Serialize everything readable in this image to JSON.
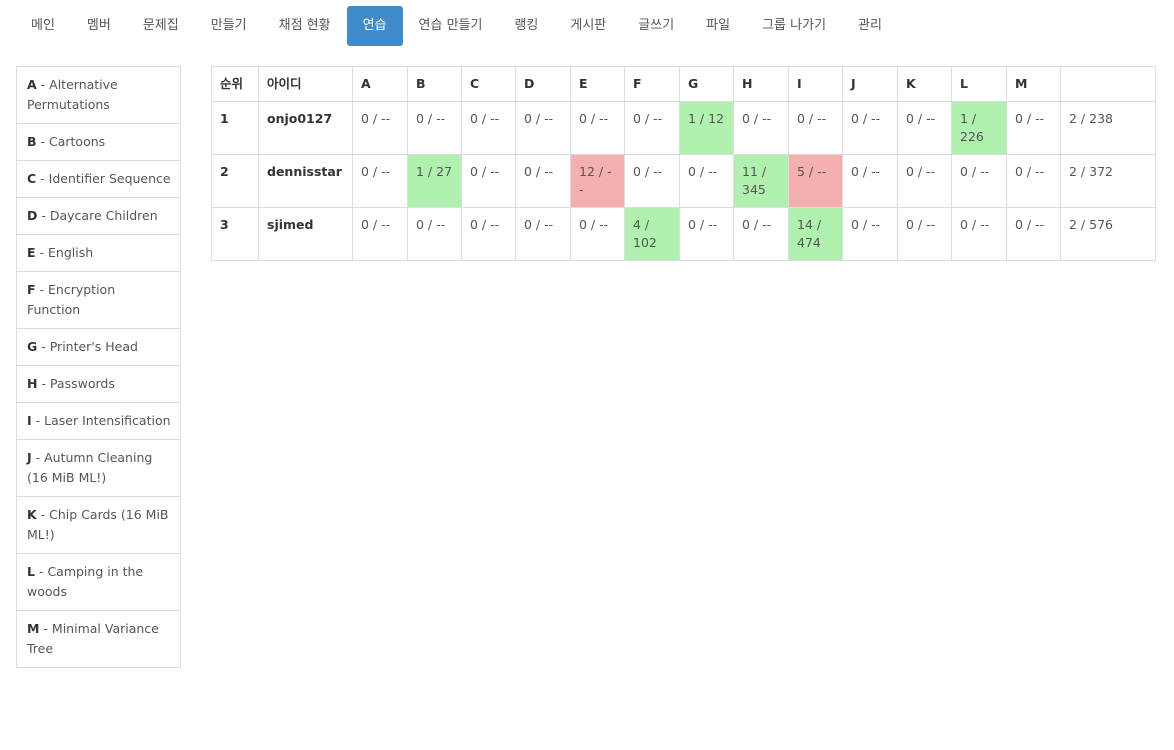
{
  "nav": {
    "tabs": [
      "메인",
      "멤버",
      "문제집",
      "만들기",
      "채점 현황",
      "연습",
      "연습 만들기",
      "랭킹",
      "게시판",
      "글쓰기",
      "파일",
      "그룹 나가기",
      "관리"
    ],
    "active": "연습"
  },
  "colors": {
    "accent": "#428bca",
    "solved": "#b0f1b0",
    "failed": "#f4b0b0"
  },
  "problems": [
    {
      "letter": "A",
      "title": "Alternative Permutations"
    },
    {
      "letter": "B",
      "title": "Cartoons"
    },
    {
      "letter": "C",
      "title": "Identifier Sequence"
    },
    {
      "letter": "D",
      "title": "Daycare Children"
    },
    {
      "letter": "E",
      "title": "English"
    },
    {
      "letter": "F",
      "title": "Encryption Function"
    },
    {
      "letter": "G",
      "title": "Printer's Head"
    },
    {
      "letter": "H",
      "title": "Passwords"
    },
    {
      "letter": "I",
      "title": "Laser Intensification"
    },
    {
      "letter": "J",
      "title": "Autumn Cleaning (16 MiB ML!)"
    },
    {
      "letter": "K",
      "title": "Chip Cards (16 MiB ML!)"
    },
    {
      "letter": "L",
      "title": "Camping in the woods"
    },
    {
      "letter": "M",
      "title": "Minimal Variance Tree"
    }
  ],
  "scoreboard": {
    "headers": [
      "순위",
      "아이디",
      "A",
      "B",
      "C",
      "D",
      "E",
      "F",
      "G",
      "H",
      "I",
      "J",
      "K",
      "L",
      "M",
      ""
    ],
    "rows": [
      {
        "rank": "1",
        "id": "onjo0127",
        "cells": [
          {
            "text": "0 / --",
            "status": "none"
          },
          {
            "text": "0 / --",
            "status": "none"
          },
          {
            "text": "0 / --",
            "status": "none"
          },
          {
            "text": "0 / --",
            "status": "none"
          },
          {
            "text": "0 / --",
            "status": "none"
          },
          {
            "text": "0 / --",
            "status": "none"
          },
          {
            "text": "1 / 12",
            "status": "ok"
          },
          {
            "text": "0 / --",
            "status": "none"
          },
          {
            "text": "0 / --",
            "status": "none"
          },
          {
            "text": "0 / --",
            "status": "none"
          },
          {
            "text": "0 / --",
            "status": "none"
          },
          {
            "text": "1 / 226",
            "status": "ok"
          },
          {
            "text": "0 / --",
            "status": "none"
          }
        ],
        "total": "2 / 238"
      },
      {
        "rank": "2",
        "id": "dennisstar",
        "cells": [
          {
            "text": "0 / --",
            "status": "none"
          },
          {
            "text": "1 / 27",
            "status": "ok"
          },
          {
            "text": "0 / --",
            "status": "none"
          },
          {
            "text": "0 / --",
            "status": "none"
          },
          {
            "text": "12 / --",
            "status": "bad"
          },
          {
            "text": "0 / --",
            "status": "none"
          },
          {
            "text": "0 / --",
            "status": "none"
          },
          {
            "text": "11 / 345",
            "status": "ok"
          },
          {
            "text": "5 / --",
            "status": "bad"
          },
          {
            "text": "0 / --",
            "status": "none"
          },
          {
            "text": "0 / --",
            "status": "none"
          },
          {
            "text": "0 / --",
            "status": "none"
          },
          {
            "text": "0 / --",
            "status": "none"
          }
        ],
        "total": "2 / 372"
      },
      {
        "rank": "3",
        "id": "sjimed",
        "cells": [
          {
            "text": "0 / --",
            "status": "none"
          },
          {
            "text": "0 / --",
            "status": "none"
          },
          {
            "text": "0 / --",
            "status": "none"
          },
          {
            "text": "0 / --",
            "status": "none"
          },
          {
            "text": "0 / --",
            "status": "none"
          },
          {
            "text": "4 / 102",
            "status": "ok"
          },
          {
            "text": "0 / --",
            "status": "none"
          },
          {
            "text": "0 / --",
            "status": "none"
          },
          {
            "text": "14 / 474",
            "status": "ok"
          },
          {
            "text": "0 / --",
            "status": "none"
          },
          {
            "text": "0 / --",
            "status": "none"
          },
          {
            "text": "0 / --",
            "status": "none"
          },
          {
            "text": "0 / --",
            "status": "none"
          }
        ],
        "total": "2 / 576"
      }
    ]
  }
}
